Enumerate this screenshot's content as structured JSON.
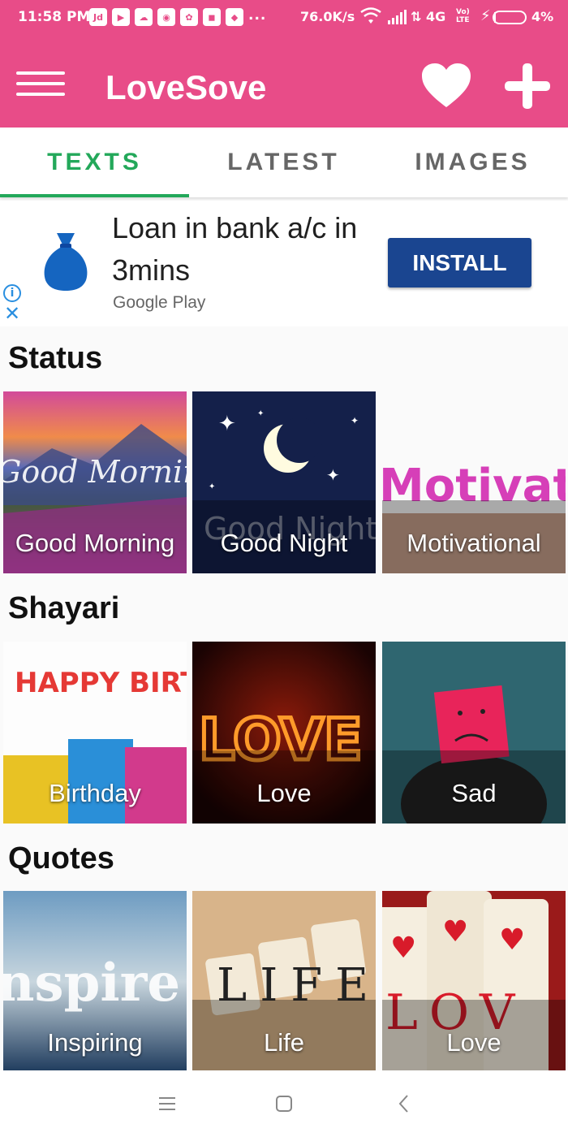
{
  "status_bar": {
    "time": "11:58 PM",
    "app_icons": [
      "Jd",
      "▶",
      "☁",
      "◉",
      "✿",
      "◼",
      "◆"
    ],
    "more": "...",
    "net_speed": "76.0K/s",
    "network": "4G",
    "volte": "Vo)\nLTE",
    "battery_pct": "4%",
    "battery_level": 0.04
  },
  "app_bar": {
    "title": "LoveSove",
    "menu_icon": "hamburger-icon",
    "fav_icon": "heart-icon",
    "add_icon": "plus-icon"
  },
  "tabs": [
    {
      "label": "TEXTS",
      "active": true
    },
    {
      "label": "LATEST",
      "active": false
    },
    {
      "label": "IMAGES",
      "active": false
    }
  ],
  "ad": {
    "headline": "Loan in bank a/c in 3mins",
    "source": "Google Play",
    "install_label": "INSTALL",
    "info_label": "i",
    "close_label": "✕"
  },
  "sections": [
    {
      "title": "Status",
      "tiles": [
        {
          "label": "Good Morning",
          "art_text": "Good Morning"
        },
        {
          "label": "Good Night",
          "art_text": "Good Night"
        },
        {
          "label": "Motivational",
          "art_text": "Motivatio"
        }
      ]
    },
    {
      "title": "Shayari",
      "tiles": [
        {
          "label": "Birthday",
          "art_text": "HAPPY BIRTHDAY"
        },
        {
          "label": "Love",
          "art_text": "LOVE"
        },
        {
          "label": "Sad",
          "art_text": ""
        }
      ]
    },
    {
      "title": "Quotes",
      "tiles": [
        {
          "label": "Inspiring",
          "art_text": "nspire"
        },
        {
          "label": "Life",
          "art_text": "LIFE"
        },
        {
          "label": "Love",
          "art_text": "LOV"
        }
      ]
    }
  ],
  "colors": {
    "primary": "#e84c88",
    "tab_active": "#23a85a",
    "install": "#1a4590"
  }
}
